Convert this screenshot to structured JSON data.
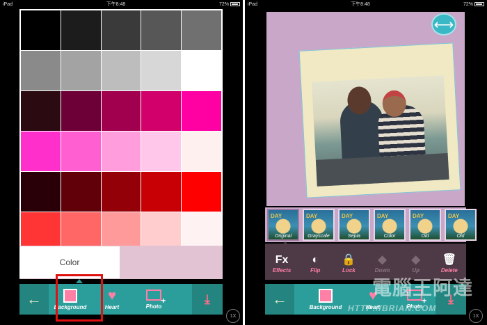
{
  "status_bar": {
    "carrier": "iPad",
    "time": "下午8:48",
    "battery": "72%"
  },
  "left": {
    "palette": [
      "#000000",
      "#1c1c1c",
      "#3a3a3a",
      "#575757",
      "#707070",
      "#8a8a8a",
      "#a3a3a3",
      "#bdbdbd",
      "#d7d7d7",
      "#ffffff",
      "#2c0a12",
      "#6e0038",
      "#a1004f",
      "#d1006b",
      "#ff00a3",
      "#ff2fcc",
      "#ff5fd1",
      "#ff9ddd",
      "#ffc8ea",
      "#fff0f0",
      "#2a0008",
      "#610008",
      "#930008",
      "#c80006",
      "#ff0000",
      "#ff3434",
      "#ff6767",
      "#ff9a9a",
      "#ffcdcd",
      "#fff2f2"
    ],
    "color_tab_label": "Color",
    "toolbar": {
      "back_icon": "←",
      "background_label": "Background",
      "heart_label": "Heart",
      "photo_label": "Photo",
      "download_icon": "⤓"
    },
    "zoom_label": "1X"
  },
  "right": {
    "swap_icon": "⟷",
    "filters": [
      {
        "label": "Original",
        "selected": true
      },
      {
        "label": "Grayscale",
        "selected": false
      },
      {
        "label": "Sepia",
        "selected": false
      },
      {
        "label": "Color",
        "selected": false
      },
      {
        "label": "Old",
        "selected": false
      },
      {
        "label": "Old",
        "selected": false
      }
    ],
    "thumb_text": "DAY",
    "edit_items": [
      {
        "glyph": "Fx",
        "label": "Effects",
        "disabled": false
      },
      {
        "glyph": "◐",
        "label": "Flip",
        "disabled": false
      },
      {
        "glyph": "🔒",
        "label": "Lock",
        "disabled": false
      },
      {
        "glyph": "◆",
        "label": "Down",
        "disabled": true
      },
      {
        "glyph": "◆",
        "label": "Up",
        "disabled": true
      },
      {
        "glyph": "🗑",
        "label": "Delete",
        "disabled": false
      }
    ],
    "toolbar": {
      "back_icon": "←",
      "background_label": "Background",
      "heart_label": "Heart",
      "photo_label": "Photo",
      "download_icon": "⤓"
    },
    "zoom_label": "1X"
  },
  "watermark": {
    "text": "電腦王阿達",
    "url": "HTTP://BRIAN.COM"
  }
}
